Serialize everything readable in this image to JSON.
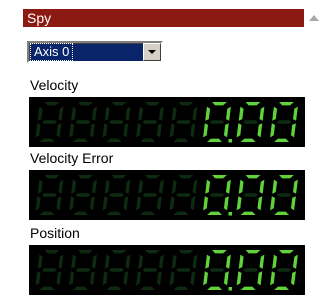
{
  "panel": {
    "title": "Spy",
    "axis_select": {
      "value": "Axis 0"
    },
    "displays": [
      {
        "label": "Velocity",
        "digits": [
          null,
          null,
          null,
          null,
          null,
          0,
          0,
          0
        ]
      },
      {
        "label": "Velocity Error",
        "digits": [
          null,
          null,
          null,
          null,
          null,
          0,
          0,
          0
        ]
      },
      {
        "label": "Position",
        "digits": [
          null,
          null,
          null,
          null,
          null,
          0,
          0,
          0
        ]
      }
    ]
  },
  "colors": {
    "title_bar": "#8b1a12",
    "lcd_background": "#000000",
    "lcd_on": "#5fd23c",
    "lcd_off": "#0e2b12",
    "select_highlight": "#0a246a"
  },
  "icons": {
    "collapse": "triangle-up-icon",
    "dropdown": "chevron-down-icon"
  }
}
